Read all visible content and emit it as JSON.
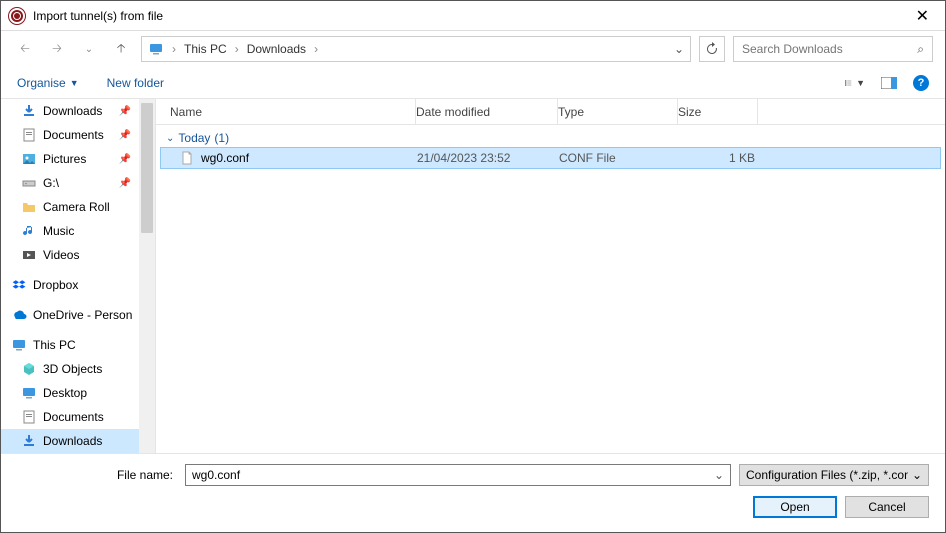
{
  "title": "Import tunnel(s) from file",
  "breadcrumbs": [
    "This PC",
    "Downloads"
  ],
  "search_placeholder": "Search Downloads",
  "toolbar": {
    "organise": "Organise",
    "newfolder": "New folder"
  },
  "columns": {
    "name": "Name",
    "date": "Date modified",
    "type": "Type",
    "size": "Size"
  },
  "group": {
    "label": "Today",
    "count": "(1)"
  },
  "file": {
    "name": "wg0.conf",
    "date": "21/04/2023 23:52",
    "type": "CONF File",
    "size": "1 KB"
  },
  "tree": {
    "downloads": "Downloads",
    "documents": "Documents",
    "pictures": "Pictures",
    "gdrive": "G:\\",
    "camera": "Camera Roll",
    "music": "Music",
    "videos": "Videos",
    "dropbox": "Dropbox",
    "onedrive": "OneDrive - Person",
    "thispc": "This PC",
    "objects3d": "3D Objects",
    "desktop": "Desktop",
    "documents2": "Documents",
    "downloads2": "Downloads"
  },
  "footer": {
    "label": "File name:",
    "value": "wg0.conf",
    "filter": "Configuration Files (*.zip, *.con",
    "open": "Open",
    "cancel": "Cancel"
  }
}
